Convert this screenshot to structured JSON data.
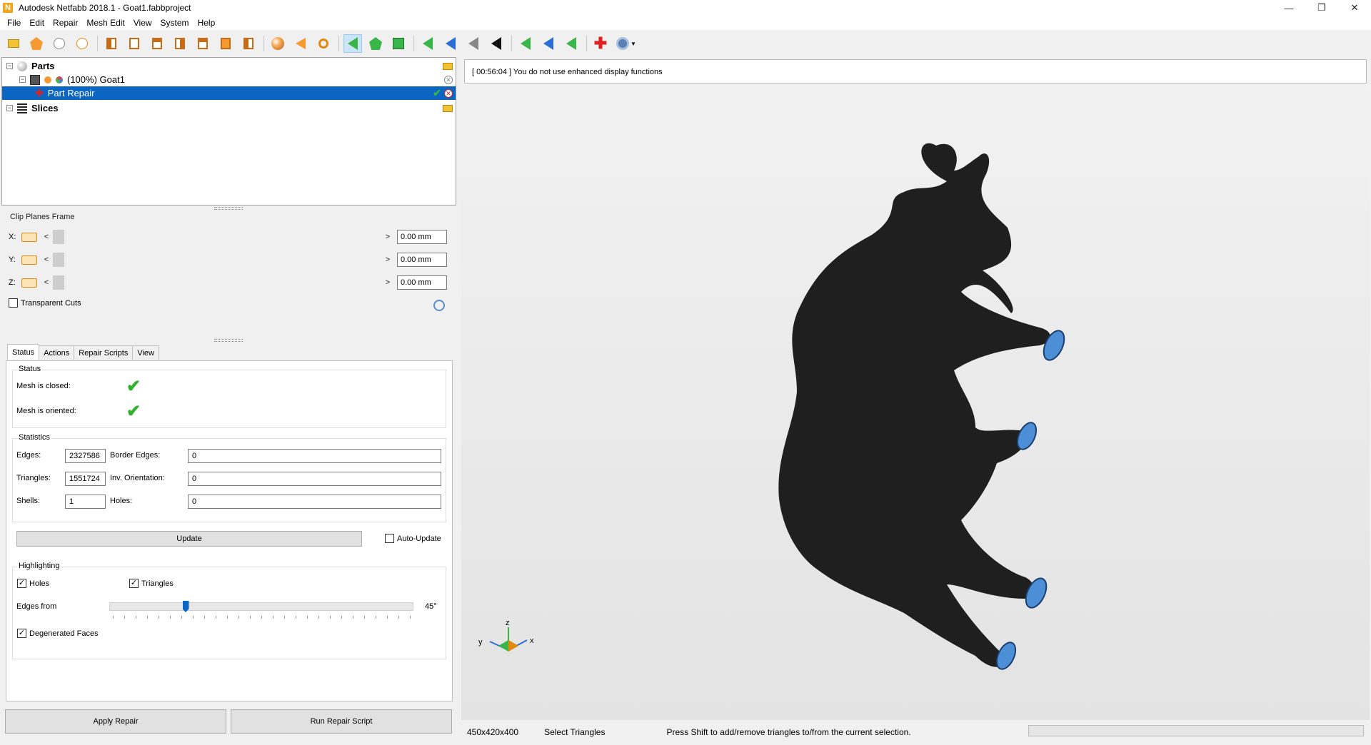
{
  "window": {
    "title": "Autodesk Netfabb 2018.1 - Goat1.fabbproject",
    "logo_letter": "N",
    "controls": [
      "—",
      "❐",
      "✕"
    ]
  },
  "menu": [
    "File",
    "Edit",
    "Repair",
    "Mesh Edit",
    "View",
    "System",
    "Help"
  ],
  "toolbar_icons": [
    "open-project-icon",
    "add-part-icon",
    "add-measure-icon",
    "add-clip-icon",
    "view-front-icon",
    "view-back-icon",
    "view-left-icon",
    "view-right-icon",
    "view-top-icon",
    "view-bottom-icon",
    "view-iso-icon",
    "shaded-sphere-icon",
    "undo-orange-icon",
    "zoom-icon",
    "select-triangle-icon",
    "select-shell-icon",
    "select-surface-icon",
    "triangle-add-icon",
    "triangle-move-icon",
    "triangle-cut-icon",
    "triangle-black-icon",
    "nav-back-green-icon",
    "nav-back-blue-icon",
    "nav-back-green2-icon",
    "repair-plus-icon",
    "settings-menu-icon"
  ],
  "tree": {
    "parts_label": "Parts",
    "part_name": "(100%) Goat1",
    "repair_label": "Part Repair",
    "slices_label": "Slices",
    "expand_parts": "−",
    "expand_goat": "−",
    "expand_slices": "−"
  },
  "clip": {
    "title": "Clip Planes Frame",
    "rows": [
      {
        "axis": "X:",
        "value": "0.00 mm"
      },
      {
        "axis": "Y:",
        "value": "0.00 mm"
      },
      {
        "axis": "Z:",
        "value": "0.00 mm"
      }
    ],
    "arrow_left": "<",
    "arrow_right": ">",
    "transparent_cuts": "Transparent Cuts"
  },
  "tabs": [
    "Status",
    "Actions",
    "Repair Scripts",
    "View"
  ],
  "status": {
    "group_title": "Status",
    "mesh_closed": "Mesh is closed:",
    "mesh_oriented": "Mesh is oriented:",
    "check": "✔"
  },
  "statistics": {
    "group_title": "Statistics",
    "edges_label": "Edges:",
    "edges": "2327586",
    "border_edges_label": "Border Edges:",
    "border_edges": "0",
    "triangles_label": "Triangles:",
    "triangles": "1551724",
    "inv_orientation_label": "Inv. Orientation:",
    "inv_orientation": "0",
    "shells_label": "Shells:",
    "shells": "1",
    "holes_label": "Holes:",
    "holes": "0",
    "update_button": "Update",
    "auto_update": "Auto-Update"
  },
  "highlighting": {
    "group_title": "Highlighting",
    "holes": "Holes",
    "triangles": "Triangles",
    "edges_from": "Edges from",
    "edges_value_label": "45°",
    "edges_value": 45,
    "edges_max": 180,
    "degenerated": "Degenerated Faces",
    "checkmark": "✓"
  },
  "bottom_buttons": {
    "apply": "Apply Repair",
    "run_script": "Run Repair Script"
  },
  "viewport": {
    "log_message": "[ 00:56:04 ] You do not use enhanced display functions",
    "axis_labels": {
      "z": "z",
      "x": "x",
      "y": "y"
    },
    "model_color": "#1f1f1f",
    "hoof_color": "#4d8fd6"
  },
  "statusbar": {
    "dimensions": "450x420x400",
    "mode": "Select Triangles",
    "hint": "Press Shift to add/remove triangles to/from the current selection."
  }
}
